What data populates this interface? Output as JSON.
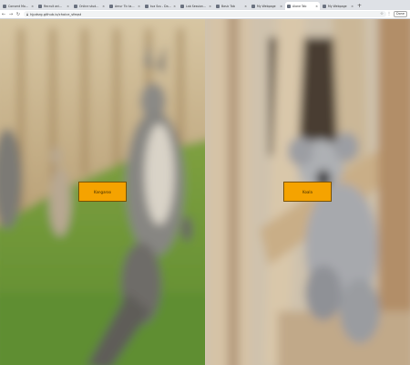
{
  "browser": {
    "tabs": [
      {
        "title": "Consent Model - Prolific",
        "active": false
      },
      {
        "title": "Recruit animal recognition",
        "active": false
      },
      {
        "title": "Online study recruiting",
        "active": false
      },
      {
        "title": "Amur Tic tam - Google Sch",
        "active": false
      },
      {
        "title": "tua Sus - Data: TBT - Chrome",
        "active": false
      },
      {
        "title": "Lab Session (19 minutes)",
        "active": false
      },
      {
        "title": "Basic Tab",
        "active": false
      },
      {
        "title": "My Webpage",
        "active": false
      },
      {
        "title": "Alone Tab",
        "active": true
      },
      {
        "title": "My Webpage",
        "active": false
      }
    ],
    "new_tab_glyph": "+",
    "url": "hjpdsrg.github.io/choice_sfeqst",
    "profile_label": "Done",
    "icons": {
      "back": "back-arrow-icon",
      "forward": "forward-arrow-icon",
      "reload": "reload-icon",
      "lock": "lock-icon",
      "star": "bookmark-star-icon",
      "extensions": "extensions-icon"
    }
  },
  "choices": {
    "left_label": "Kangaroo",
    "right_label": "Koala"
  },
  "colors": {
    "button_fill": "#f5a300",
    "button_border": "#7a5200"
  }
}
